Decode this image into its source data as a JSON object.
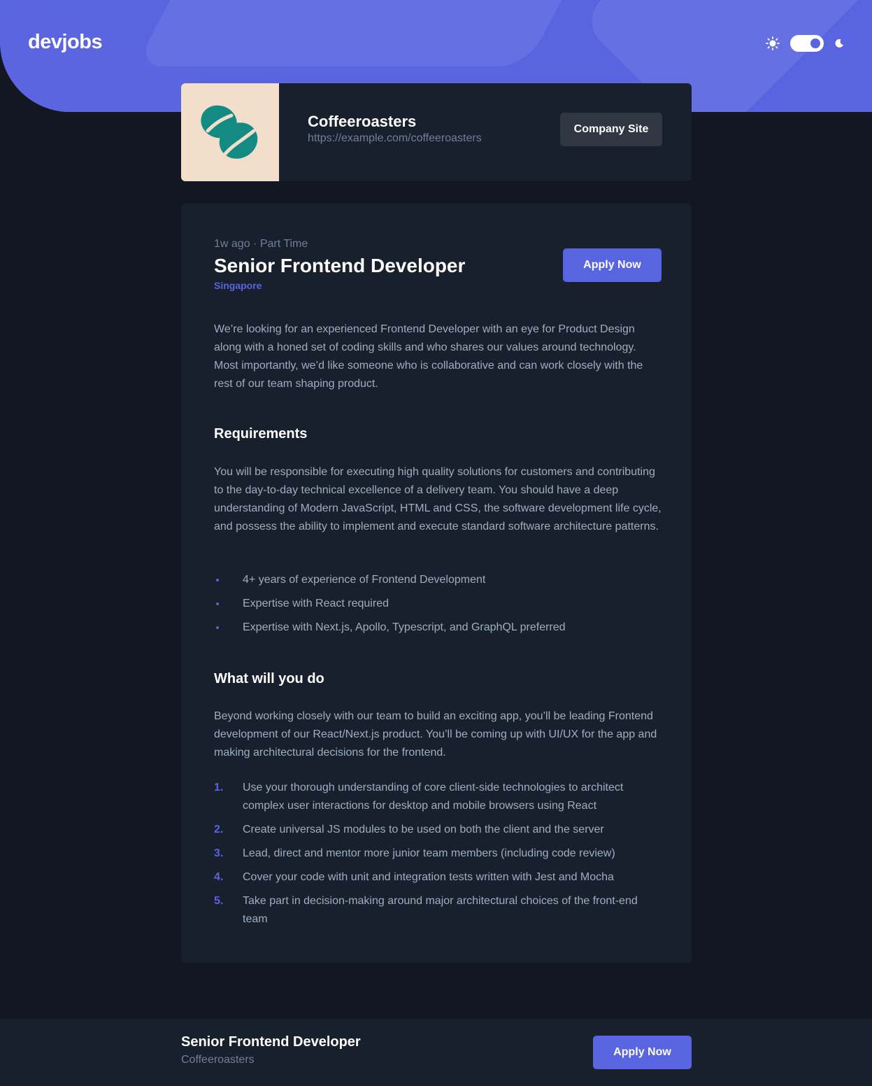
{
  "header": {
    "logo": "devjobs",
    "theme": {
      "sun_icon": "sun-icon",
      "moon_icon": "moon-icon",
      "dark_mode": true
    }
  },
  "company": {
    "name": "Coffeeroasters",
    "url": "https://example.com/coffeeroasters",
    "site_button": "Company Site",
    "logo_icon": "coffee-beans-icon",
    "logo_bg": "#F3DECC",
    "logo_color": "#138A82"
  },
  "job": {
    "meta": "1w ago · Part Time",
    "title": "Senior Frontend Developer",
    "location": "Singapore",
    "apply_label": "Apply Now",
    "description": "We’re looking for an experienced Frontend Developer with an eye for Product Design along with a honed set of coding skills and who shares our values around technology. Most importantly, we’d like someone who is collaborative and can work closely with the rest of our team shaping product.",
    "requirements": {
      "title": "Requirements",
      "content": "You will be responsible for executing high quality solutions for customers and contributing to the day-to-day technical excellence of a delivery team. You should have a deep understanding of Modern JavaScript, HTML and CSS, the software development life cycle, and possess the ability to implement and execute standard software architecture patterns.",
      "items": [
        "4+ years of experience of Frontend Development",
        "Expertise with React required",
        "Expertise with Next.js, Apollo, Typescript, and GraphQL preferred"
      ]
    },
    "role": {
      "title": "What will you do",
      "content": "Beyond working closely with our team to build an exciting app, you’ll be leading Frontend development of our React/Next.js product. You’ll be coming up with UI/UX for the app and making architectural decisions for the frontend.",
      "items": [
        {
          "num": "1.",
          "text": "Use your thorough understanding of core client-side technologies to architect complex user interactions for desktop and mobile browsers using React"
        },
        {
          "num": "2.",
          "text": "Create universal JS modules to be used on both the client and the server"
        },
        {
          "num": "3.",
          "text": "Lead, direct and mentor more junior team members (including code review)"
        },
        {
          "num": "4.",
          "text": "Cover your code with unit and integration tests written with Jest and Mocha"
        },
        {
          "num": "5.",
          "text": "Take part in decision-making around major architectural choices of the front-end team"
        }
      ]
    }
  },
  "footer": {
    "title": "Senior Frontend Developer",
    "company": "Coffeeroasters",
    "apply_label": "Apply Now"
  },
  "colors": {
    "accent": "#5964E0",
    "background": "#121721",
    "card": "#19202D",
    "text_muted": "#9DAEC2",
    "text_gray": "#6E8098"
  }
}
